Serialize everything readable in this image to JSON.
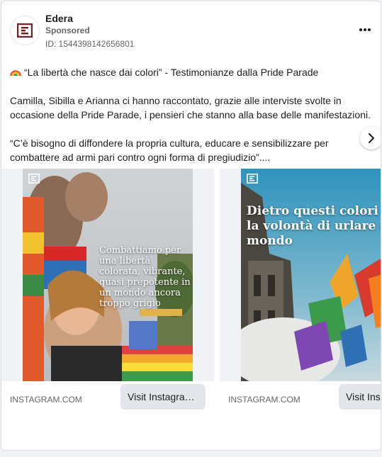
{
  "header": {
    "page_name": "Edera",
    "sponsored": "Sponsored",
    "ad_id": "ID: 1544398142656801"
  },
  "body": {
    "title_emoji": "rainbow-icon",
    "title": "“La libertà che nasce dai colori” - Testimonianze dalla Pride Parade",
    "paragraph1": "Camilla, Sibilla e Arianna ci hanno raccontato, grazie alle interviste svolte in occasione della Pride Parade, i pensieri che stanno alla base delle manifestazioni.",
    "paragraph2": "“C’è bisogno di diffondere la propria cultura, educare e sensibilizzare per combattere ad armi pari contro ogni forma di pregiudizio”...."
  },
  "carousel": {
    "slides": [
      {
        "overlay_text": "Combattiamo per una libertà colorata, vibrante, quasi prepotente in un mondo ancora troppo grigio",
        "domain": "INSTAGRAM.COM",
        "button_label": "Visit Instagram profile"
      },
      {
        "overlay_text": "Dietro questi colori c’è la volontà di urlare al mondo",
        "domain": "INSTAGRAM.COM",
        "button_label": "Visit Instagram profile"
      }
    ]
  },
  "colors": {
    "brand": "#7a1f1f",
    "text_secondary": "#65676b",
    "button_bg": "#e4e6eb"
  }
}
